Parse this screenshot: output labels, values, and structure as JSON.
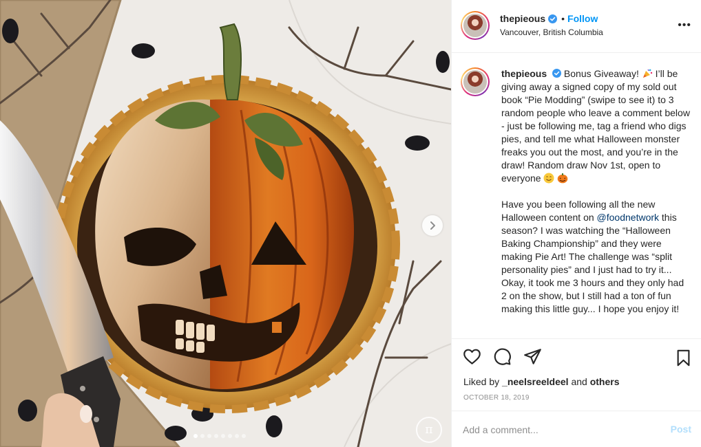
{
  "post": {
    "username": "thepieous",
    "location": "Vancouver, British Columbia",
    "follow_label": "Follow",
    "separator": "•",
    "more_label": "•••"
  },
  "caption": {
    "username": "thepieous",
    "text_part1": "Bonus Giveaway! ",
    "text_part2": " I’ll be giving away a signed copy of my sold out book “Pie Modding” (swipe to see it) to 3 random people who leave a comment below - just be following me, tag a friend who digs pies, and tell me what Halloween monster freaks you out the most, and you’re in the draw! Random draw Nov 1st, open to everyone ",
    "text_part3": "\n\nHave you been following all the new Halloween content on ",
    "mention": "@foodnetwork",
    "text_part4": " this season? I was watching the “Halloween Baking Championship” and they were making Pie Art! The challenge was “split personality pies” and I just had to try it... Okay, it took me 3 hours and they only had 2 on the show, but I still had a ton of fun making this little guy... I hope you enjoy it!"
  },
  "icons": {
    "like": "heart-icon",
    "comment": "comment-icon",
    "share": "paper-plane-icon",
    "save": "bookmark-icon",
    "next": "chevron-right-icon",
    "verified": "verified-badge-icon",
    "more": "more-options-icon"
  },
  "likes": {
    "prefix": "Liked by ",
    "user": "_neelsreeldeel",
    "middle": " and ",
    "others": "others"
  },
  "date": "OCTOBER 18, 2019",
  "comment_box": {
    "placeholder": "Add a comment...",
    "post_label": "Post"
  },
  "carousel": {
    "total_slides": 8,
    "active_index": 0,
    "watermark": "π"
  },
  "colors": {
    "accent": "#0095f6",
    "post_disabled": "#b2dffc",
    "text": "#262626",
    "muted": "#8e8e8e",
    "verified": "#3897f0"
  }
}
